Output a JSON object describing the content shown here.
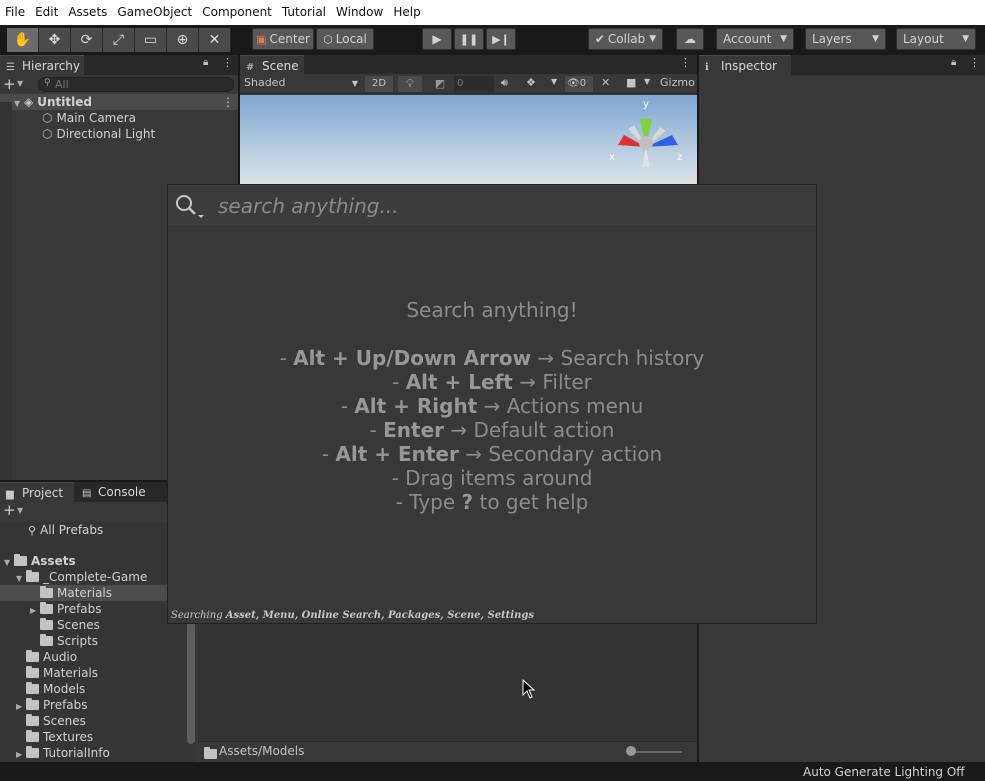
{
  "menu": [
    "File",
    "Edit",
    "Assets",
    "GameObject",
    "Component",
    "Tutorial",
    "Window",
    "Help"
  ],
  "toolbar": {
    "tools": [
      "hand-tool-icon",
      "move-tool-icon",
      "rotate-tool-icon",
      "scale-tool-icon",
      "rect-tool-icon",
      "transform-tool-icon",
      "custom-tool-icon"
    ],
    "pivot": "Center",
    "space": "Local",
    "collab": "Collab",
    "account": "Account",
    "layers": "Layers",
    "layout": "Layout"
  },
  "hierarchy": {
    "tab": "Hierarchy",
    "search_placeholder": "All",
    "scene": "Untitled",
    "items": [
      "Main Camera",
      "Directional Light"
    ]
  },
  "scene_view": {
    "tab": "Scene",
    "shading": "Shaded",
    "mode_2d": "2D",
    "count": "0",
    "hidden_count": "0",
    "gizmos": "Gizmo",
    "axis_x": "x",
    "axis_y": "y",
    "axis_z": "z"
  },
  "inspector": {
    "tab": "Inspector"
  },
  "project": {
    "tab": "Project",
    "console_tab": "Console",
    "favorite": "All Prefabs",
    "root": "Assets",
    "tree": [
      {
        "label": "_Complete-Game",
        "depth": 1,
        "expanded": true
      },
      {
        "label": "Materials",
        "depth": 2,
        "selected": true
      },
      {
        "label": "Prefabs",
        "depth": 2,
        "collapsed": true
      },
      {
        "label": "Scenes",
        "depth": 2
      },
      {
        "label": "Scripts",
        "depth": 2
      },
      {
        "label": "Audio",
        "depth": 1
      },
      {
        "label": "Materials",
        "depth": 1
      },
      {
        "label": "Models",
        "depth": 1
      },
      {
        "label": "Prefabs",
        "depth": 1,
        "collapsed": true
      },
      {
        "label": "Scenes",
        "depth": 1
      },
      {
        "label": "Textures",
        "depth": 1
      },
      {
        "label": "TutorialInfo",
        "depth": 1,
        "collapsed": true
      }
    ],
    "path": "Assets/Models"
  },
  "search": {
    "placeholder": "search anything...",
    "heading": "Search anything!",
    "lines": [
      {
        "prefix": "- ",
        "key": "Alt + Up/Down Arrow",
        "text": " → Search history"
      },
      {
        "prefix": "- ",
        "key": "Alt + Left",
        "text": " → Filter"
      },
      {
        "prefix": "- ",
        "key": "Alt + Right",
        "text": " → Actions menu"
      },
      {
        "prefix": "- ",
        "key": "Enter",
        "text": " → Default action"
      },
      {
        "prefix": "- ",
        "key": "Alt + Enter",
        "text": " → Secondary action"
      },
      {
        "prefix": "- ",
        "key": "",
        "text": "Drag items around"
      },
      {
        "prefix": "- Type ",
        "key": "?",
        "text": " to get help"
      }
    ],
    "searching_label": "Searching",
    "providers": "Asset, Menu, Online Search, Packages, Scene, Settings"
  },
  "status": {
    "lighting": "Auto Generate Lighting Off"
  }
}
